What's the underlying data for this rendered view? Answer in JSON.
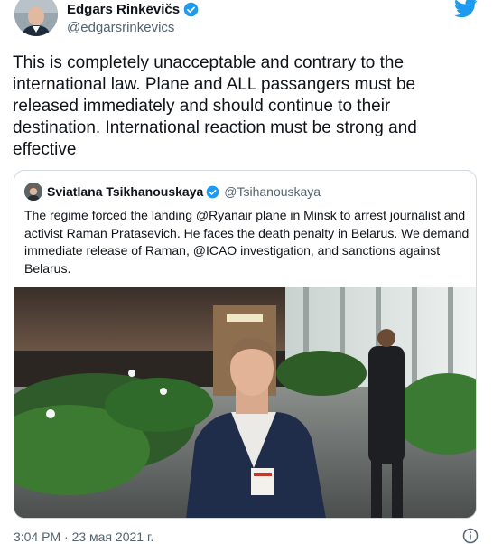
{
  "author": {
    "name": "Edgars Rinkēvičs",
    "handle": "@edgarsrinkevics",
    "avatar_icon": "profile-photo",
    "verified": true
  },
  "tweet": {
    "text": "This is completely unacceptable and contrary to the international law. Plane and ALL passangers must be released immediately and should continue to their destination. International reaction must be strong and effective"
  },
  "quoted_tweet": {
    "name": "Sviatlana Tsikhanouskaya",
    "handle": "@Tsihanouskaya",
    "verified": true,
    "text": "The regime forced the landing @Ryanair plane in Minsk to arrest journalist and activist Raman Pratasevich. He faces the death penalty in Belarus. We demand immediate release of Raman, @ICAO investigation, and sanctions against Belarus."
  },
  "footer": {
    "timestamp": "3:04 PM · 23 мая 2021 г."
  },
  "colors": {
    "twitter_blue": "#1d9bf0",
    "text": "#0f1419",
    "secondary": "#536471",
    "border": "#cfd9de"
  }
}
